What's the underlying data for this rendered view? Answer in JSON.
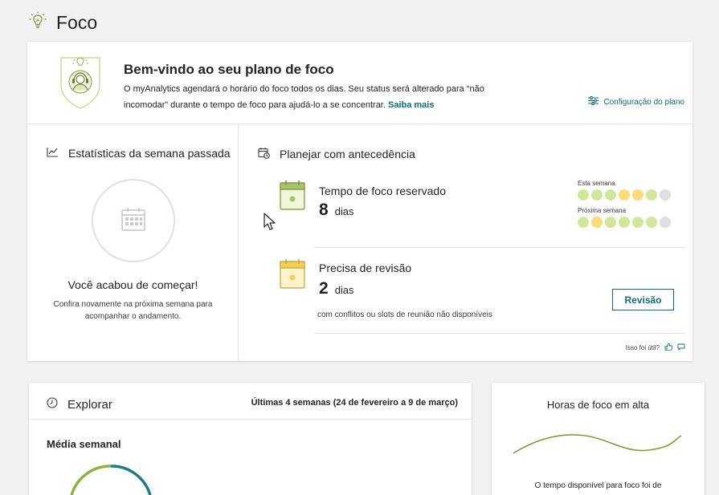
{
  "page": {
    "title": "Foco"
  },
  "welcome": {
    "title": "Bem-vindo ao seu plano de foco",
    "description": "O myAnalytics agendará o horário do foco todos os dias. Seu status será alterado para “não incomodar” durante o tempo de foco para ajudá-lo a se concentrar.",
    "learn_more": "Saiba mais",
    "plan_settings": "Configuração do plano"
  },
  "stats": {
    "title": "Estatísticas da semana passada",
    "headline": "Você acabou de começar!",
    "message": "Confira novamente na próxima semana para acompanhar o andamento."
  },
  "plan": {
    "title": "Planejar com antecedência",
    "reserved": {
      "label": "Tempo de foco reservado",
      "count": "8",
      "unit": "dias"
    },
    "this_week": {
      "label": "Esta semana",
      "days": [
        "green",
        "green",
        "green",
        "yellow",
        "yellow",
        "green",
        "grey"
      ]
    },
    "next_week": {
      "label": "Próxima semana",
      "days": [
        "green",
        "yellow",
        "green",
        "green",
        "green",
        "green",
        "grey"
      ]
    },
    "review": {
      "label": "Precisa de revisão",
      "count": "2",
      "unit": "dias",
      "note": "com conflitos ou slots de reunião não disponíveis",
      "button": "Revisão"
    }
  },
  "feedback": {
    "question": "Isso foi útil?"
  },
  "explore": {
    "title": "Explorar",
    "range": "Últimas 4 semanas (24 de fevereiro a 9 de março)",
    "weekly_average": "Média semanal"
  },
  "trend": {
    "title": "Horas de foco em alta",
    "description": "O tempo disponível para foco foi de"
  },
  "colors": {
    "accent": "#0f6e7a",
    "green": "#d2e79a",
    "yellow": "#f9dd7a",
    "grey": "#dedede",
    "trend_line": "#8a9a3b"
  }
}
